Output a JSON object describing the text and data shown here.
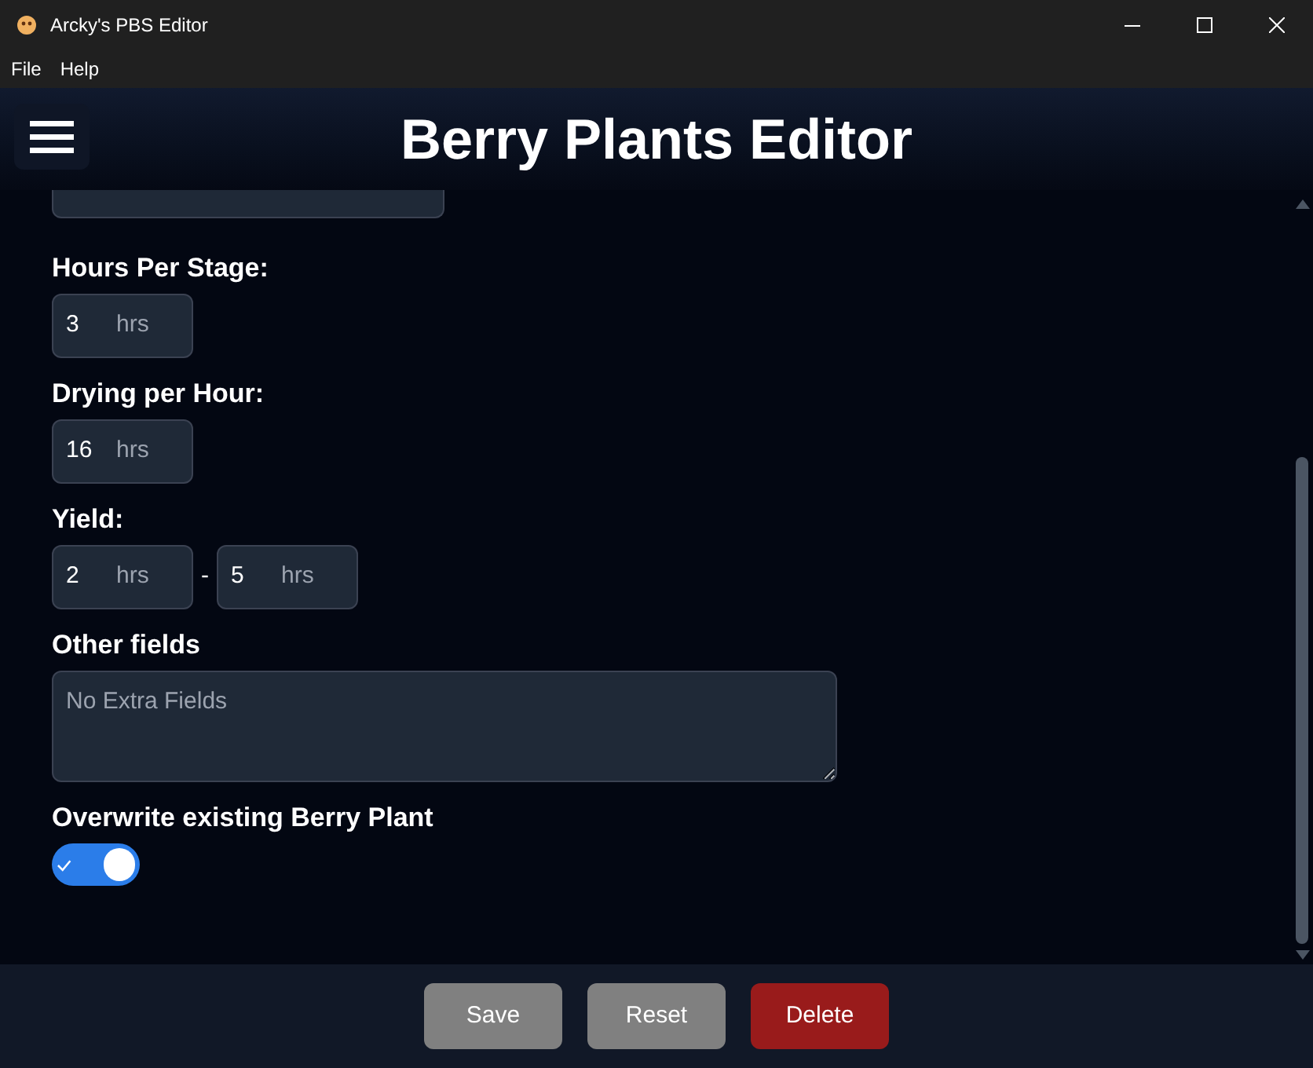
{
  "window": {
    "title": "Arcky's PBS Editor"
  },
  "menu": [
    "File",
    "Help"
  ],
  "header": {
    "title": "Berry Plants Editor"
  },
  "fields": [
    {
      "kind": "single",
      "label": "Hours Per Stage:",
      "inputs": [
        {
          "value": "3",
          "unit": "hrs"
        }
      ]
    },
    {
      "kind": "single",
      "label": "Drying per Hour:",
      "inputs": [
        {
          "value": "16",
          "unit": "hrs"
        }
      ]
    },
    {
      "kind": "range",
      "label": "Yield:",
      "separator": "-",
      "inputs": [
        {
          "value": "2",
          "unit": "hrs"
        },
        {
          "value": "5",
          "unit": "hrs"
        }
      ]
    },
    {
      "kind": "textarea",
      "label": "Other fields",
      "placeholder": "No Extra Fields"
    },
    {
      "kind": "toggle",
      "label": "Overwrite existing Berry Plant",
      "on": true
    }
  ],
  "buttons": [
    {
      "label": "Save",
      "kind": "neutral"
    },
    {
      "label": "Reset",
      "kind": "neutral"
    },
    {
      "label": "Delete",
      "kind": "danger"
    }
  ]
}
